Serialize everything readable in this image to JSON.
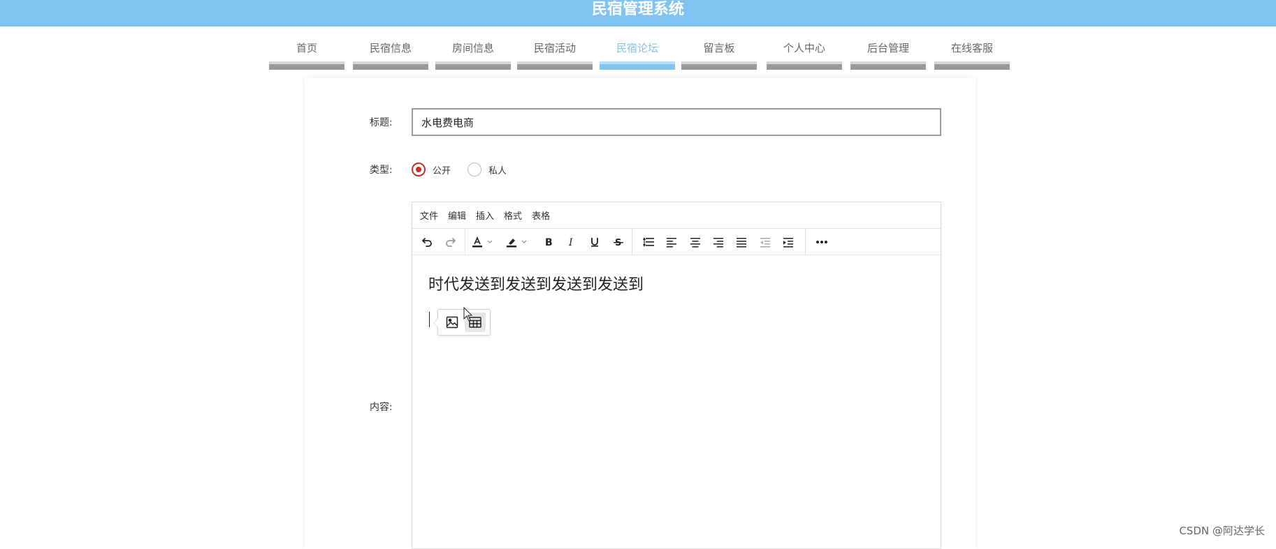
{
  "header": {
    "title": "民宿管理系统"
  },
  "nav": {
    "items": [
      {
        "label": "首页"
      },
      {
        "label": "民宿信息"
      },
      {
        "label": "房间信息"
      },
      {
        "label": "民宿活动"
      },
      {
        "label": "民宿论坛",
        "active": true
      },
      {
        "label": "留言板"
      },
      {
        "label": "个人中心"
      },
      {
        "label": "后台管理"
      },
      {
        "label": "在线客服"
      }
    ]
  },
  "form": {
    "title_label": "标题:",
    "title_value": "水电费电商",
    "type_label": "类型:",
    "type_options": [
      {
        "label": "公开",
        "checked": true
      },
      {
        "label": "私人",
        "checked": false
      }
    ],
    "content_label": "内容:"
  },
  "editor": {
    "menu": [
      "文件",
      "编辑",
      "插入",
      "格式",
      "表格"
    ],
    "toolbar_icons": [
      "undo-icon",
      "redo-icon",
      "font-color-icon",
      "highlight-icon",
      "bold-icon",
      "italic-icon",
      "underline-icon",
      "strikethrough-icon",
      "line-height-icon",
      "align-left-icon",
      "align-center-icon",
      "align-right-icon",
      "align-justify-icon",
      "outdent-icon",
      "indent-icon",
      "more-icon"
    ],
    "content_text": "时代发送到发送到发送到发送到",
    "quickbar_icons": [
      "image-icon",
      "table-icon"
    ]
  },
  "colors": {
    "header": "#81c3f0",
    "active_tab": "#81c3f0",
    "radio_checked": "#c9302c"
  },
  "watermark": "CSDN @阿达学长"
}
